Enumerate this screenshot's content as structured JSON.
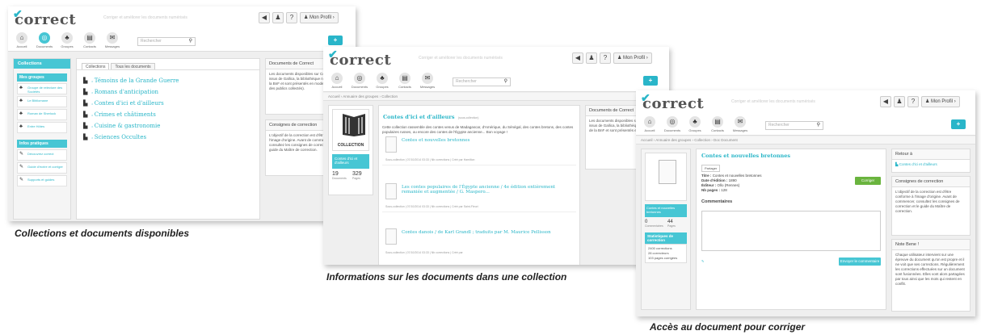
{
  "app": {
    "logo": "correct",
    "tagline": "Corriger et améliorer les documents numérisés",
    "profile_label": "Mon Profil",
    "search_placeholder": "Rechercher",
    "plus_label": "+",
    "accent_color": "#47c6d4",
    "nav": [
      {
        "label": "Accueil",
        "icon": "home-icon"
      },
      {
        "label": "Documents",
        "icon": "binoculars-icon"
      },
      {
        "label": "Groupes",
        "icon": "group-icon"
      },
      {
        "label": "Contacts",
        "icon": "contacts-icon"
      },
      {
        "label": "Messages",
        "icon": "messages-icon"
      }
    ],
    "top_icons": [
      {
        "glyph": "◀",
        "icon": "megaphone-icon"
      },
      {
        "glyph": "♟",
        "icon": "user-icon"
      },
      {
        "glyph": "?",
        "icon": "help-icon"
      }
    ]
  },
  "screen1": {
    "collections_title": "Collections",
    "my_groups_title": "Mes groupes",
    "groups": [
      "Groupe de relecture des Sociétés",
      "Le Bibliomane",
      "Roman de Sherlock",
      "Entre Hôtes"
    ],
    "practical_title": "Infos pratiques",
    "practical": [
      "Découvrez correct",
      "Guide d'écrire et corriger",
      "Supports et guides"
    ],
    "tabs": [
      "Collections",
      "Tous les documents"
    ],
    "collections": [
      "Témoins de la Grande Guerre",
      "Romans d'anticipation",
      "Contes d'ici et d'ailleurs",
      "Crimes et châtiments",
      "Cuisine & gastronomie",
      "Sciences Occultes"
    ],
    "right_box1_title": "Documents de Correct",
    "right_box1_text": "Les documents disponibles sur Correct sont issus de Gallica, la bibliothèque numérique de la BnF et sont présentés en mode texte (format des publics collectés).",
    "right_box2_title": "Consignes de correction",
    "right_box2_text": "L'objectif de la correction est d'être conforme à l'image d'origine. Avant de commencer, consultez les consignes de correction et le guide du Maître de correction."
  },
  "screen2": {
    "breadcrumb": "Accueil › Annuaire des groupes › Collection",
    "collection_badge": "COLLECTION",
    "collection_caption": "Contes d'ici et d'ailleurs",
    "stats": [
      {
        "value": "19",
        "label": "Documents"
      },
      {
        "value": "329",
        "label": "Pages"
      }
    ],
    "title": "Contes d'ici et d'ailleurs",
    "title_suffix": "(sous-collection)",
    "description": "Cette collection rassemble des contes venus de Madagascar, d'Amérique, du Sénégal, des contes bretons, des contes populaires russes, ou encore des contes de l'Égypte ancienne... Bon voyage !",
    "docs": [
      {
        "title": "Contes et nouvelles bretonnes",
        "meta": "Sous-collection | 07/10/2014 03:33 | Nb corrections | Créé par Hamilton"
      },
      {
        "title": "Les contes populaires de l'Égypte ancienne / 4e édition entièrement remaniée et augmentée / G. Maspero...",
        "meta": "Sous-collection | 07/10/2014 03:33 | Nb corrections | Créé par Saint-Fleuri"
      },
      {
        "title": "Contes danois / de Karl Grandl ; traduits par M. Maurice Pellisson",
        "meta": "Sous-collection | 07/10/2014 03:33 | Nb corrections | Créé par"
      }
    ],
    "right_box_title": "Documents de Correct",
    "right_box_text": "Les documents disponibles sur Correct sont issus de Gallica, la bibliothèque numérique de la BnF et sont présentés en mode texte."
  },
  "screen3": {
    "breadcrumb": "Accueil › Annuaire des groupes › Collection › Doc Document",
    "doc_title": "Contes et nouvelles bretonnes",
    "share_label": "Partager",
    "meta_lines": [
      {
        "key": "Titre :",
        "value": "Contes et nouvelles bretonnes"
      },
      {
        "key": "Date d'édition :",
        "value": "1890"
      },
      {
        "key": "Éditeur :",
        "value": "Ollo (Rennes)"
      },
      {
        "key": "Nb pages :",
        "value": "128"
      }
    ],
    "correct_button": "Corriger",
    "comments_label": "Commentaires",
    "submit_label": "Envoyer le commentaire",
    "stats": [
      {
        "value": "0",
        "label": "Commentaires"
      },
      {
        "value": "44",
        "label": "Pages"
      }
    ],
    "stats_title": "Statistiques de correction",
    "stats_lines": [
      "2400 corrections",
      "28 correcteurs",
      "103 pages corrigées"
    ],
    "back_title": "Retour à",
    "back_link": "Contes d'ici et d'ailleurs",
    "consignes_title": "Consignes de correction",
    "consignes_text": "L'objectif de la correction est d'être conforme à l'image d'origine. Avant de commencer, consultez les consignes de correction et le guide du Maître de correction.",
    "note_title": "Note Bene !",
    "note_text": "Chaque utilisateur intervient sur une épreuve du document qu'on est propre et il ne voit que ses corrections. Régulièrement les corrections effectuées sur un document sont fusionnées. Elles vont alors partagées par tous ainsi que les mots qui restent en conflit."
  },
  "captions": {
    "c1": "Collections et documents disponibles",
    "c2": "Informations sur les documents dans une collection",
    "c3": "Accès au document pour corriger"
  }
}
